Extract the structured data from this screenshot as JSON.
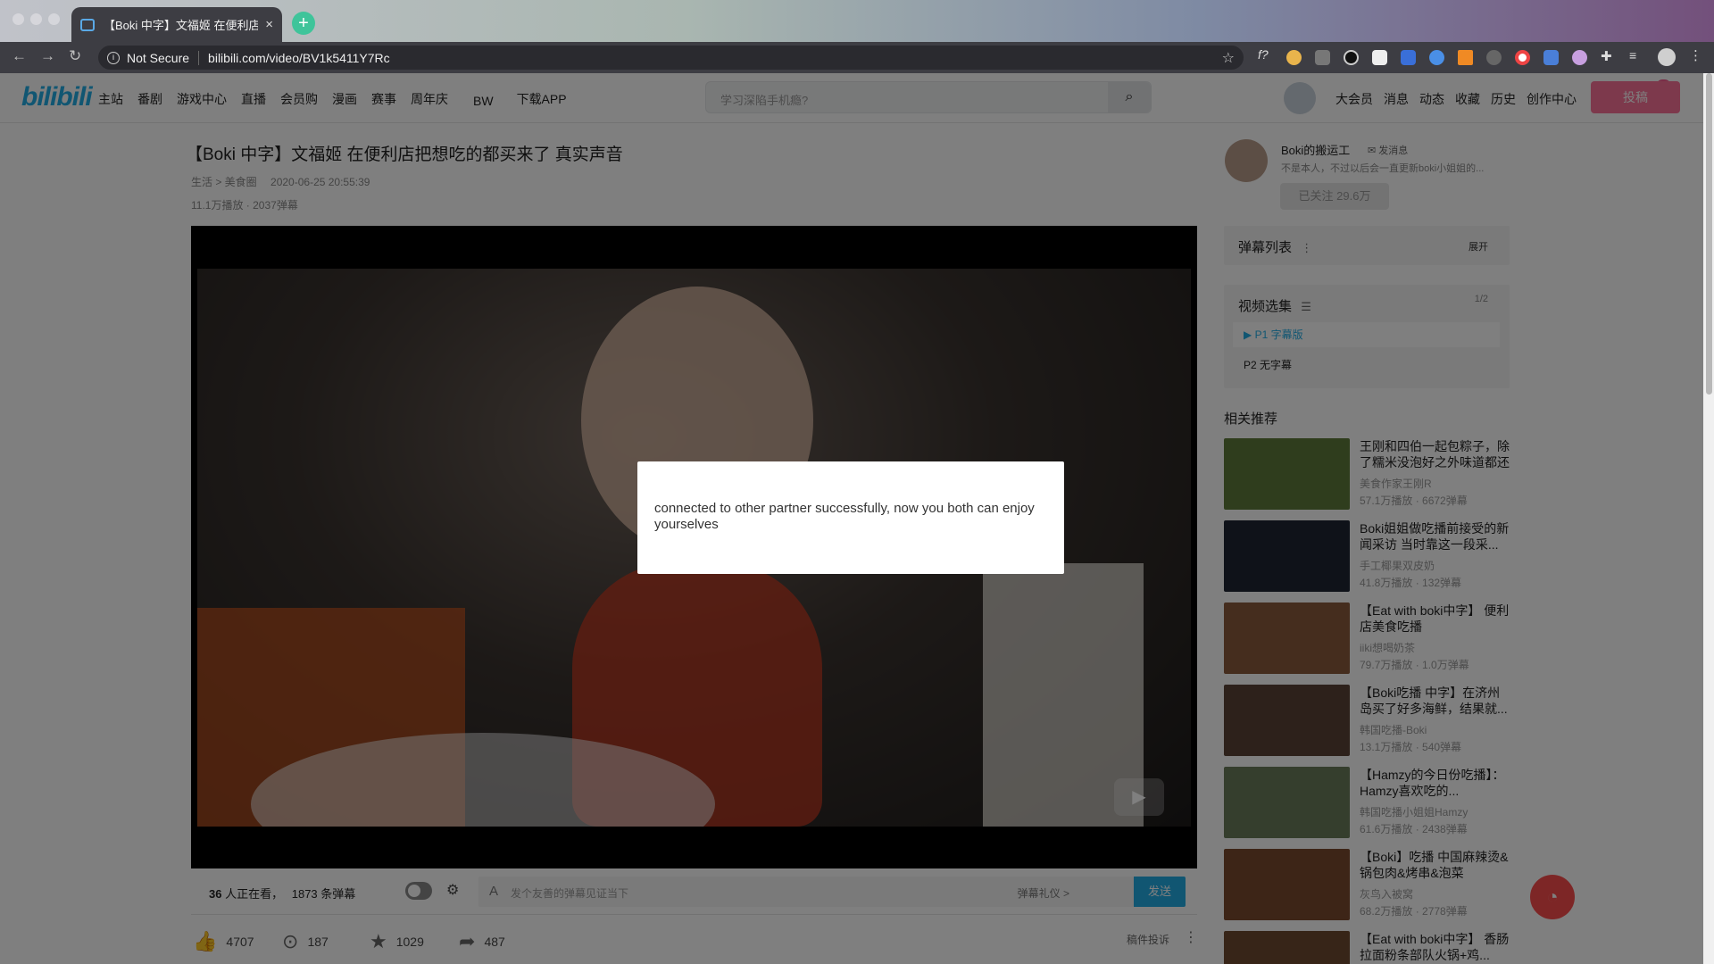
{
  "browser": {
    "tab_title": "【Boki 中字】文福姬 在便利店把",
    "tab_close": "×",
    "new_tab": "+",
    "security": "Not Secure",
    "url": "bilibili.com/video/BV1k5411Y7Rc"
  },
  "header": {
    "logo": "bilibili",
    "nav": [
      "主站",
      "番剧",
      "游戏中心",
      "直播",
      "会员购",
      "漫画",
      "赛事",
      "周年庆",
      "BW",
      "下载APP"
    ],
    "search_placeholder": "学习深陷手机瘾?",
    "right_nav": [
      "大会员",
      "消息",
      "动态",
      "收藏",
      "历史",
      "创作中心"
    ],
    "message_badge": "13",
    "upload": "投稿"
  },
  "video": {
    "title": "【Boki 中字】文福姬 在便利店把想吃的都买来了 真实声音",
    "category": "生活 > 美食圈",
    "date": "2020-06-25 20:55:39",
    "stats": "11.1万播放 · 2037弹幕"
  },
  "controls": {
    "watching_count": "36",
    "watching_text": "人正在看，",
    "danmaku_count": "1873 条弹幕",
    "danmaku_placeholder": "发个友善的弹幕见证当下",
    "danmaku_gift": "弹幕礼仪 >",
    "send": "发送"
  },
  "actions": {
    "like": "4707",
    "coin": "187",
    "favorite": "1029",
    "share": "487",
    "report": "稿件投诉"
  },
  "uploader": {
    "name": "Boki的搬运工",
    "message": "发消息",
    "desc": "不是本人，不过以后会一直更新boki小姐姐的...",
    "follow": "已关注 29.6万"
  },
  "danmaku_list": {
    "title": "弹幕列表",
    "expand": "展开"
  },
  "episodes": {
    "title": "视频选集",
    "count": "1/2",
    "items": [
      {
        "label": "P1   字幕版"
      },
      {
        "label": "P2   无字幕"
      }
    ]
  },
  "related": {
    "heading": "相关推荐",
    "items": [
      {
        "title": "王刚和四伯一起包粽子，除了糯米没泡好之外味道都还",
        "up": "美食作家王刚R",
        "stats": "57.1万播放 · 6672弹幕",
        "color": "#5f7a3a"
      },
      {
        "title": "Boki姐姐做吃播前接受的新闻采访 当时靠这一段采...",
        "up": "手工椰果双皮奶",
        "stats": "41.8万播放 · 132弹幕",
        "color": "#1e2433"
      },
      {
        "title": "【Eat with boki中字】 便利店美食吃播",
        "up": "iiki想喝奶茶",
        "stats": "79.7万播放 · 1.0万弹幕",
        "color": "#8a5a3c"
      },
      {
        "title": "【Boki吃播 中字】在济州岛买了好多海鲜，结果就...",
        "up": "韩国吃播-Boki",
        "stats": "13.1万播放 · 540弹幕",
        "color": "#5a4236"
      },
      {
        "title": "【Hamzy的今日份吃播】：Hamzy喜欢吃的...",
        "up": "韩国吃播小姐姐Hamzy",
        "stats": "61.6万播放 · 2438弹幕",
        "color": "#6b7c5a"
      },
      {
        "title": "【Boki】吃播 中国麻辣烫&锅包肉&烤串&泡菜",
        "up": "灰鸟入被窝",
        "stats": "68.2万播放 · 2778弹幕",
        "color": "#7a4a2e"
      },
      {
        "title": "【Eat with boki中字】 香肠拉面粉条部队火锅+鸡...",
        "up": "",
        "stats": "",
        "color": "#6e4a30"
      }
    ]
  },
  "dialog": {
    "message": "connected to other partner successfully, now you both can enjoy yourselves"
  },
  "colors": {
    "brand": "#23ade5",
    "upload": "#fb7299",
    "send": "#23ade5"
  }
}
